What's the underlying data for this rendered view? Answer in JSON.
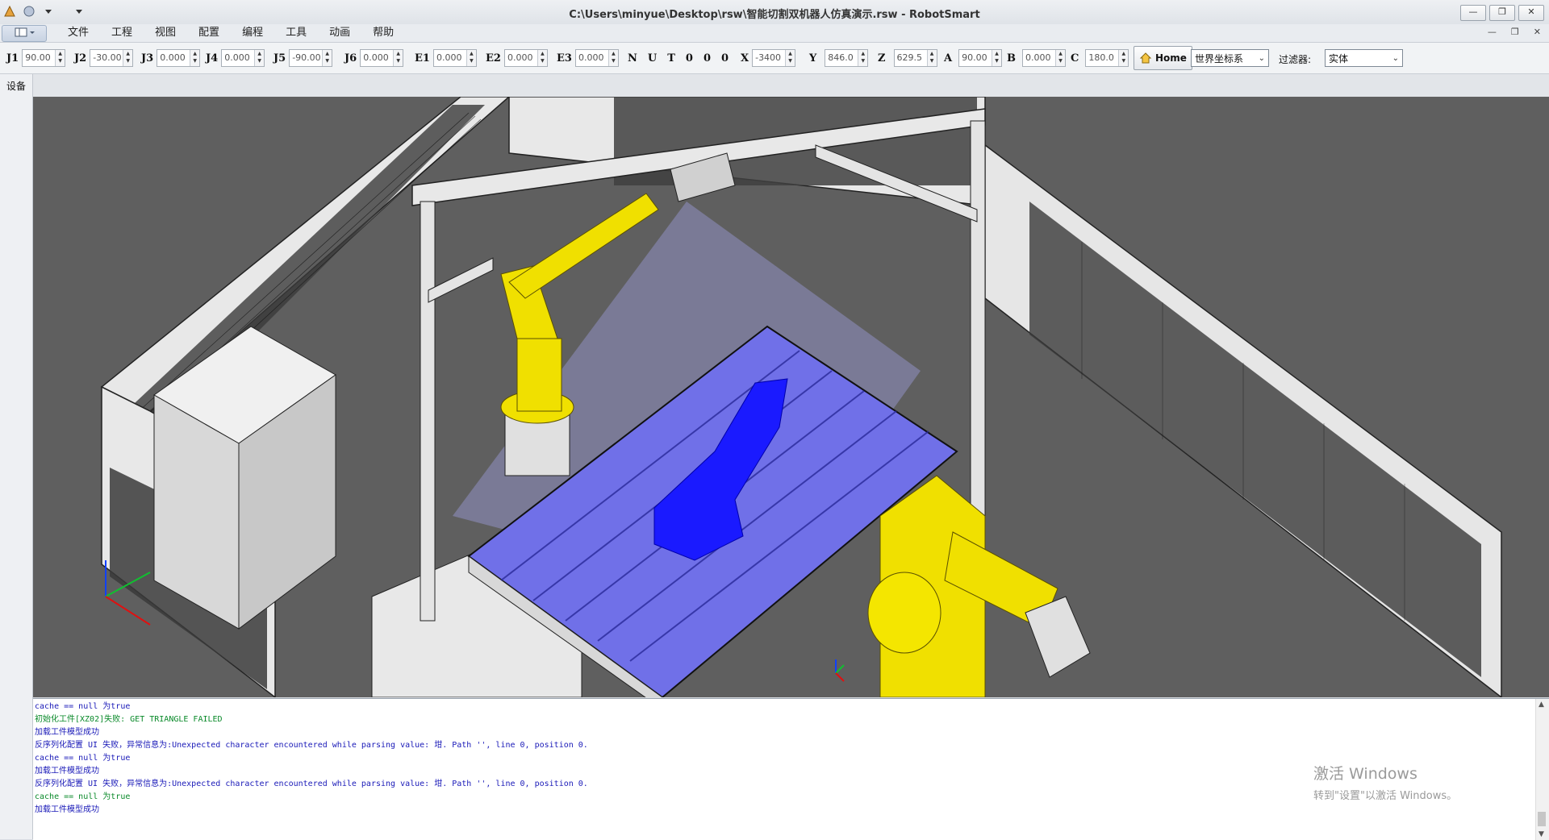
{
  "window": {
    "title": "C:\\Users\\minyue\\Desktop\\rsw\\智能切割双机器人仿真演示.rsw - RobotSmart",
    "minimize": "—",
    "restore": "❐",
    "close": "✕"
  },
  "menu": {
    "items": [
      "文件",
      "工程",
      "视图",
      "配置",
      "编程",
      "工具",
      "动画",
      "帮助"
    ]
  },
  "toolbar": {
    "j1": {
      "label": "J1",
      "value": "90.00"
    },
    "j2": {
      "label": "J2",
      "value": "-30.00"
    },
    "j3": {
      "label": "J3",
      "value": "0.000"
    },
    "j4": {
      "label": "J4",
      "value": "0.000"
    },
    "j5": {
      "label": "J5",
      "value": "-90.00"
    },
    "j6": {
      "label": "J6",
      "value": "0.000"
    },
    "e1": {
      "label": "E1",
      "value": "0.000"
    },
    "e2": {
      "label": "E2",
      "value": "0.000"
    },
    "e3": {
      "label": "E3",
      "value": "0.000"
    },
    "flags": [
      "N",
      "U",
      "T",
      "0",
      "0",
      "0"
    ],
    "x": {
      "label": "X",
      "value": "-3400"
    },
    "y": {
      "label": "Y",
      "value": "846.0"
    },
    "z": {
      "label": "Z",
      "value": "629.5"
    },
    "a": {
      "label": "A",
      "value": "90.00"
    },
    "b": {
      "label": "B",
      "value": "0.000"
    },
    "c": {
      "label": "C",
      "value": "180.0"
    },
    "home_label": "Home",
    "coord_system": "世界坐标系",
    "filter_label": "过滤器:",
    "filter_value": "实体"
  },
  "left_panel": {
    "tab": "设备"
  },
  "log": {
    "lines": [
      {
        "text": "cache == null 为true",
        "color": "#1a1ab8"
      },
      {
        "text": "初始化工件[XZ02]失败: GET TRIANGLE FAILED",
        "color": "#0a8a2a"
      },
      {
        "text": "加载工件模型成功",
        "color": "#1a1ab8"
      },
      {
        "text": "反序列化配置 UI 失败，异常信息为:Unexpected character encountered while parsing value: 坩. Path '', line 0, position 0.",
        "color": "#1a1ab8"
      },
      {
        "text": "cache == null 为true",
        "color": "#1a1ab8"
      },
      {
        "text": "加载工件模型成功",
        "color": "#1a1ab8"
      },
      {
        "text": "反序列化配置 UI 失败，异常信息为:Unexpected character encountered while parsing value: 坩. Path '', line 0, position 0.",
        "color": "#1a1ab8"
      },
      {
        "text": "cache == null 为true",
        "color": "#0a8a2a"
      },
      {
        "text": "加载工件模型成功",
        "color": "#1a1ab8"
      }
    ]
  },
  "watermark": {
    "line1": "激活 Windows",
    "line2": "转到\"设置\"以激活 Windows。"
  },
  "colors": {
    "viewport_bg": "#5f5f5f",
    "robot_yellow": "#f0e000",
    "table_purple": "#7070e8",
    "workpiece_blue": "#1a1aff"
  }
}
